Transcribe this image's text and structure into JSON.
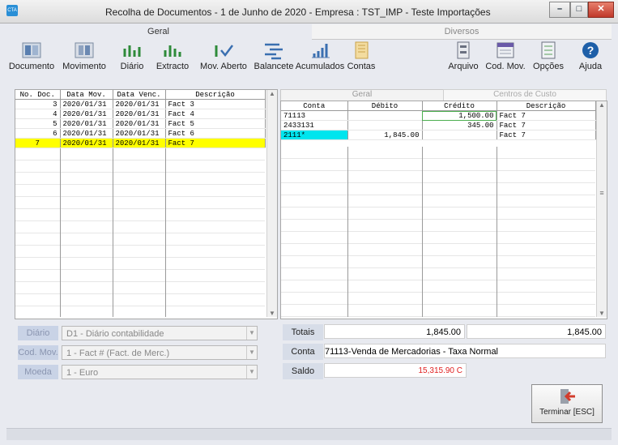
{
  "window": {
    "title": "Recolha de Documentos  - 1 de Junho de 2020 - Empresa : TST_IMP - Teste Importações",
    "app_icon_label": "CTA",
    "minimize": "–",
    "maximize": "□",
    "close": "✕"
  },
  "tabs": {
    "geral": "Geral",
    "diversos": "Diversos"
  },
  "toolbar": {
    "documento": "Documento",
    "movimento": "Movimento",
    "diario": "Diário",
    "extracto": "Extracto",
    "mov_aberto": "Mov. Aberto",
    "balancete": "Balancete",
    "acumulados": "Acumulados",
    "contas": "Contas",
    "arquivo": "Arquivo",
    "cod_mov": "Cod. Mov.",
    "opcoes": "Opções",
    "ajuda": "Ajuda"
  },
  "docs": {
    "headers": [
      "No. Doc.",
      "Data Mov.",
      "Data Venc.",
      "Descrição"
    ],
    "rows": [
      [
        "3",
        "2020/01/31",
        "2020/01/31",
        "Fact 3"
      ],
      [
        "4",
        "2020/01/31",
        "2020/01/31",
        "Fact 4"
      ],
      [
        "5",
        "2020/01/31",
        "2020/01/31",
        "Fact 5"
      ],
      [
        "6",
        "2020/01/31",
        "2020/01/31",
        "Fact 6"
      ],
      [
        "7",
        "2020/01/31",
        "2020/01/31",
        "Fact 7"
      ]
    ],
    "selected_index": 4
  },
  "lines": {
    "tabs": {
      "geral": "Geral",
      "centros": "Centros de Custo"
    },
    "headers": [
      "Conta",
      "Débito",
      "Crédito",
      "Descrição"
    ],
    "rows": [
      [
        "71113",
        "",
        "1,500.00",
        "Fact 7"
      ],
      [
        "2433131",
        "",
        "345.00",
        "Fact 7"
      ],
      [
        "2111*",
        "1,845.00",
        "",
        "Fact 7"
      ]
    ]
  },
  "fields": {
    "diario_label": "Diário",
    "diario_value": "D1     - Diário contabilidade",
    "codmov_label": "Cod. Mov.",
    "codmov_value": "1     - Fact #  (Fact. de Merc.)",
    "moeda_label": "Moeda",
    "moeda_value": "1     - Euro"
  },
  "totals": {
    "totais_label": "Totais",
    "debito": "1,845.00",
    "credito": "1,845.00",
    "conta_label": "Conta",
    "conta_value": "71113-Venda de Mercadorias - Taxa Normal",
    "saldo_label": "Saldo",
    "saldo_value": "15,315.90 C"
  },
  "terminar": "Terminar [ESC]",
  "colors": {
    "selected_row": "#ffff00",
    "cyan_cell": "#00e5ee",
    "saldo": "#e02020"
  }
}
